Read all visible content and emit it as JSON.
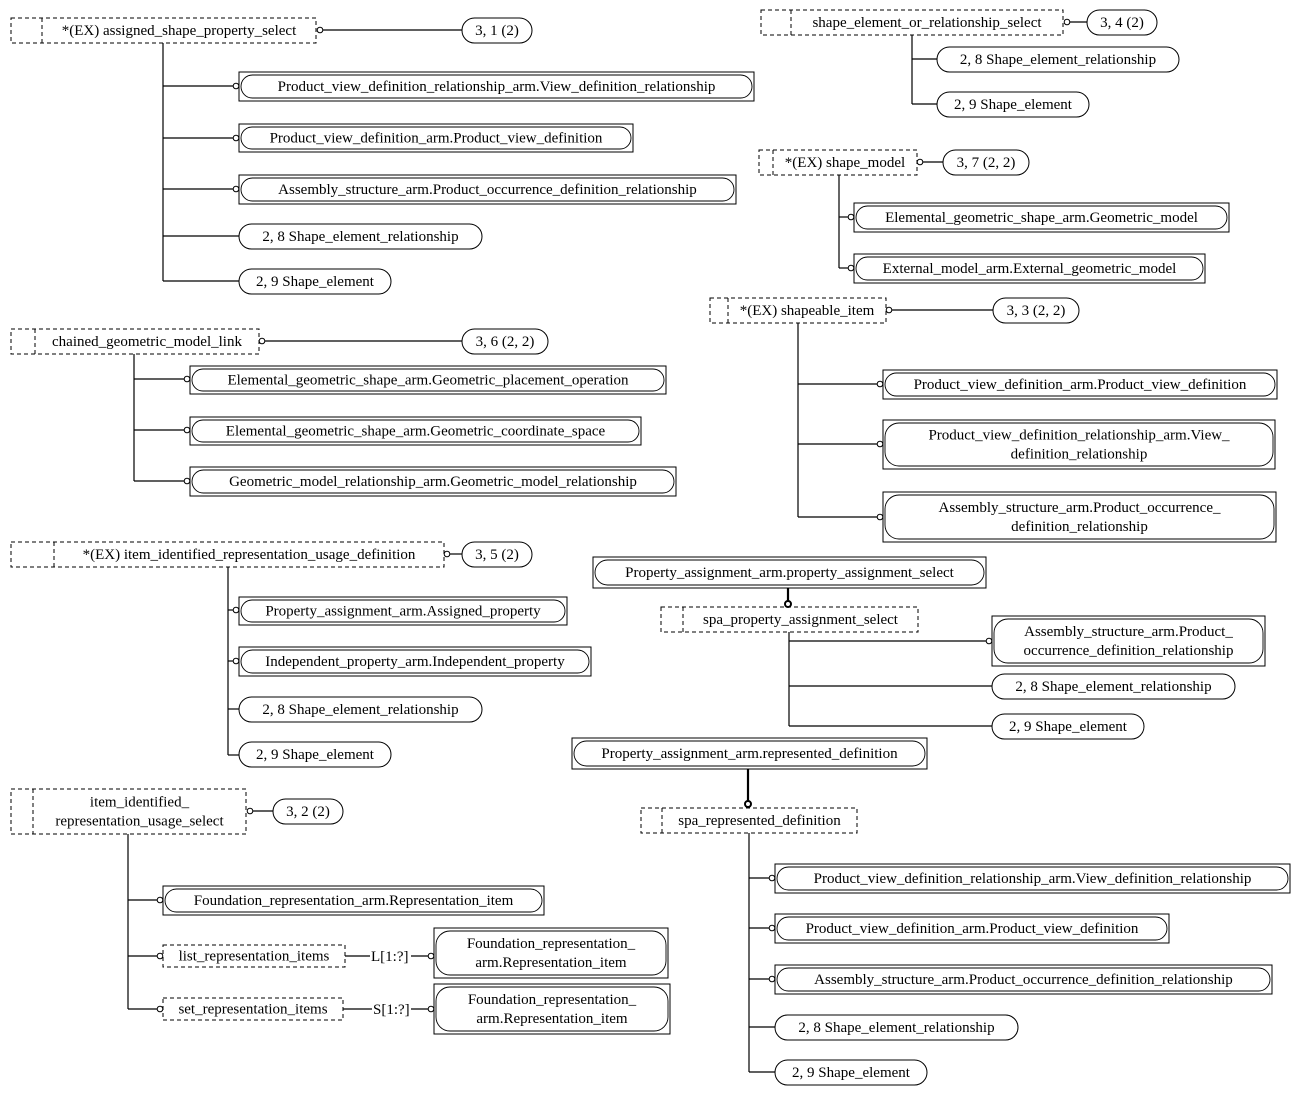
{
  "colors": {
    "stroke": "#000000",
    "background": "#ffffff"
  },
  "nodes": {
    "s1": {
      "kind": "select",
      "lines": [
        "*(EX) assigned_shape_property_select"
      ]
    },
    "s1p": {
      "kind": "page-ref",
      "lines": [
        "3, 1 (2)"
      ]
    },
    "s1c1": {
      "kind": "entity-ref",
      "lines": [
        "Product_view_definition_relationship_arm.View_definition_relationship"
      ]
    },
    "s1c2": {
      "kind": "entity-ref",
      "lines": [
        "Product_view_definition_arm.Product_view_definition"
      ]
    },
    "s1c3": {
      "kind": "entity-ref",
      "lines": [
        "Assembly_structure_arm.Product_occurrence_definition_relationship"
      ]
    },
    "s1c4": {
      "kind": "page-ref",
      "lines": [
        "2, 8 Shape_element_relationship"
      ]
    },
    "s1c5": {
      "kind": "page-ref",
      "lines": [
        "2, 9 Shape_element"
      ]
    },
    "s2": {
      "kind": "select",
      "lines": [
        "chained_geometric_model_link"
      ]
    },
    "s2p": {
      "kind": "page-ref",
      "lines": [
        "3, 6 (2, 2)"
      ]
    },
    "s2c1": {
      "kind": "entity-ref",
      "lines": [
        "Elemental_geometric_shape_arm.Geometric_placement_operation"
      ]
    },
    "s2c2": {
      "kind": "entity-ref",
      "lines": [
        "Elemental_geometric_shape_arm.Geometric_coordinate_space"
      ]
    },
    "s2c3": {
      "kind": "entity-ref",
      "lines": [
        "Geometric_model_relationship_arm.Geometric_model_relationship"
      ]
    },
    "s3": {
      "kind": "select",
      "lines": [
        "*(EX) item_identified_representation_usage_definition"
      ]
    },
    "s3p": {
      "kind": "page-ref",
      "lines": [
        "3, 5 (2)"
      ]
    },
    "s3c1": {
      "kind": "entity-ref",
      "lines": [
        "Property_assignment_arm.Assigned_property"
      ]
    },
    "s3c2": {
      "kind": "entity-ref",
      "lines": [
        "Independent_property_arm.Independent_property"
      ]
    },
    "s3c3": {
      "kind": "page-ref",
      "lines": [
        "2, 8 Shape_element_relationship"
      ]
    },
    "s3c4": {
      "kind": "page-ref",
      "lines": [
        "2, 9 Shape_element"
      ]
    },
    "s4": {
      "kind": "select",
      "lines": [
        "item_identified_",
        "representation_usage_select"
      ]
    },
    "s4p": {
      "kind": "page-ref",
      "lines": [
        "3, 2 (2)"
      ]
    },
    "s4c1": {
      "kind": "entity-ref",
      "lines": [
        "Foundation_representation_arm.Representation_item"
      ]
    },
    "s4c2": {
      "kind": "type",
      "lines": [
        "list_representation_items"
      ]
    },
    "s4c2agg": {
      "kind": "aggregate",
      "lines": [
        "L[1:?]"
      ]
    },
    "s4c2t": {
      "kind": "entity-ref",
      "lines": [
        "Foundation_representation_",
        "arm.Representation_item"
      ]
    },
    "s4c3": {
      "kind": "type",
      "lines": [
        "set_representation_items"
      ]
    },
    "s4c3agg": {
      "kind": "aggregate",
      "lines": [
        "S[1:?]"
      ]
    },
    "s4c3t": {
      "kind": "entity-ref",
      "lines": [
        "Foundation_representation_",
        "arm.Representation_item"
      ]
    },
    "r1": {
      "kind": "select",
      "lines": [
        "shape_element_or_relationship_select"
      ]
    },
    "r1p": {
      "kind": "page-ref",
      "lines": [
        "3, 4 (2)"
      ]
    },
    "r1c1": {
      "kind": "page-ref",
      "lines": [
        "2, 8 Shape_element_relationship"
      ]
    },
    "r1c2": {
      "kind": "page-ref",
      "lines": [
        "2, 9 Shape_element"
      ]
    },
    "r2": {
      "kind": "select",
      "lines": [
        "*(EX) shape_model"
      ]
    },
    "r2p": {
      "kind": "page-ref",
      "lines": [
        "3, 7 (2, 2)"
      ]
    },
    "r2c1": {
      "kind": "entity-ref",
      "lines": [
        "Elemental_geometric_shape_arm.Geometric_model"
      ]
    },
    "r2c2": {
      "kind": "entity-ref",
      "lines": [
        "External_model_arm.External_geometric_model"
      ]
    },
    "r3": {
      "kind": "select",
      "lines": [
        "*(EX) shapeable_item"
      ]
    },
    "r3p": {
      "kind": "page-ref",
      "lines": [
        "3, 3 (2, 2)"
      ]
    },
    "r3c1": {
      "kind": "entity-ref",
      "lines": [
        "Product_view_definition_arm.Product_view_definition"
      ]
    },
    "r3c2": {
      "kind": "entity-ref",
      "lines": [
        "Product_view_definition_relationship_arm.View_",
        "definition_relationship"
      ]
    },
    "r3c3": {
      "kind": "entity-ref",
      "lines": [
        "Assembly_structure_arm.Product_occurrence_",
        "definition_relationship"
      ]
    },
    "r4super": {
      "kind": "entity-ref",
      "lines": [
        "Property_assignment_arm.property_assignment_select"
      ]
    },
    "r4": {
      "kind": "select",
      "lines": [
        "spa_property_assignment_select"
      ]
    },
    "r4c1": {
      "kind": "entity-ref",
      "lines": [
        "Assembly_structure_arm.Product_",
        "occurrence_definition_relationship"
      ]
    },
    "r4c2": {
      "kind": "page-ref",
      "lines": [
        "2, 8 Shape_element_relationship"
      ]
    },
    "r4c3": {
      "kind": "page-ref",
      "lines": [
        "2, 9 Shape_element"
      ]
    },
    "r5super": {
      "kind": "entity-ref",
      "lines": [
        "Property_assignment_arm.represented_definition"
      ]
    },
    "r5": {
      "kind": "select",
      "lines": [
        "spa_represented_definition"
      ]
    },
    "r5c1": {
      "kind": "entity-ref",
      "lines": [
        "Product_view_definition_relationship_arm.View_definition_relationship"
      ]
    },
    "r5c2": {
      "kind": "entity-ref",
      "lines": [
        "Product_view_definition_arm.Product_view_definition"
      ]
    },
    "r5c3": {
      "kind": "entity-ref",
      "lines": [
        "Assembly_structure_arm.Product_occurrence_definition_relationship"
      ]
    },
    "r5c4": {
      "kind": "page-ref",
      "lines": [
        "2, 8 Shape_element_relationship"
      ]
    },
    "r5c5": {
      "kind": "page-ref",
      "lines": [
        "2, 9 Shape_element"
      ]
    }
  }
}
